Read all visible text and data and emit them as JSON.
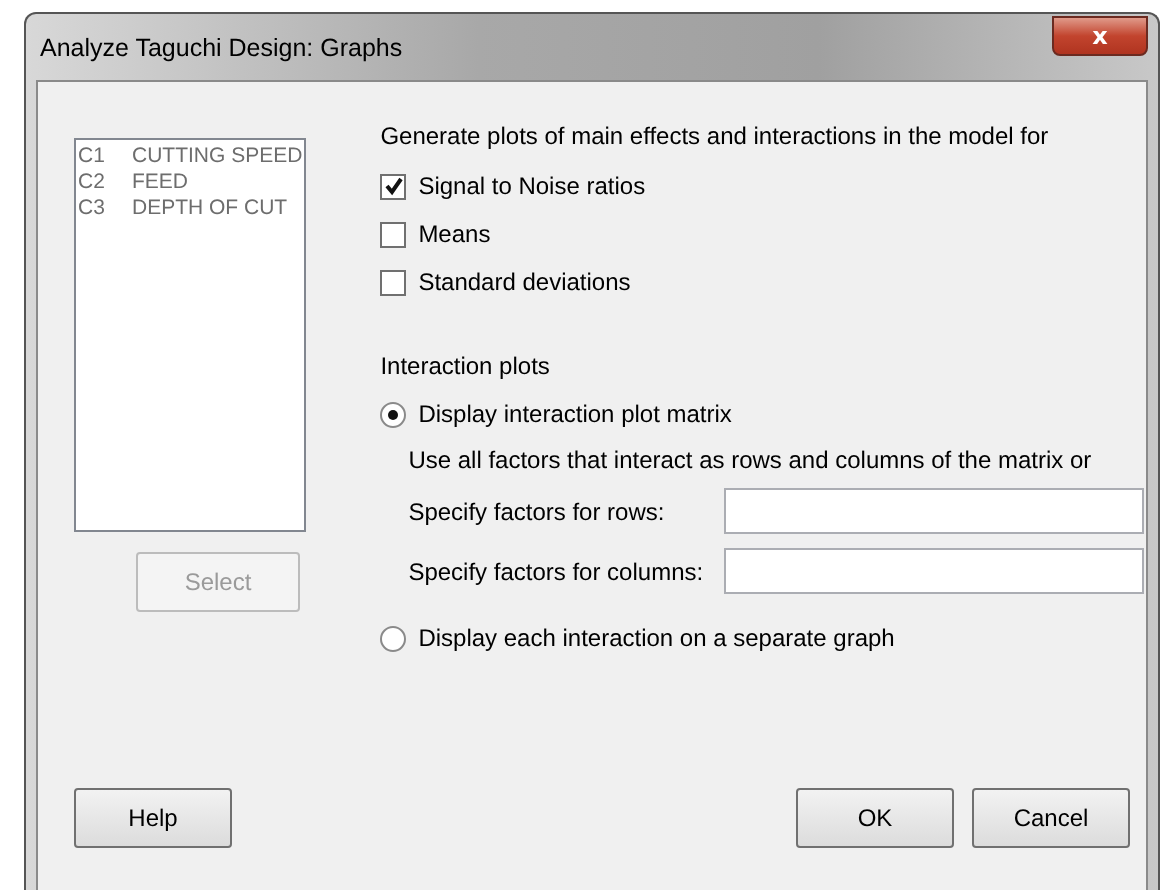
{
  "window": {
    "title": "Analyze Taguchi Design: Graphs",
    "close": "x"
  },
  "variables": [
    {
      "id": "C1",
      "name": "CUTTING SPEED"
    },
    {
      "id": "C2",
      "name": "FEED"
    },
    {
      "id": "C3",
      "name": "DEPTH OF CUT"
    }
  ],
  "select_button": {
    "label": "Select",
    "disabled": true
  },
  "plots_heading": "Generate plots of main effects and interactions in the model for",
  "plot_options": [
    {
      "label": "Signal to Noise ratios",
      "checked": true
    },
    {
      "label": "Means",
      "checked": false
    },
    {
      "label": "Standard deviations",
      "checked": false
    }
  ],
  "interaction_heading": "Interaction plots",
  "matrix_option": {
    "label": "Display interaction plot matrix",
    "selected": true
  },
  "matrix_note": "Use all factors that interact as rows and columns of the matrix or",
  "fields": [
    {
      "label": "Specify factors for rows:"
    },
    {
      "label": "Specify factors for columns:"
    }
  ],
  "separate_option": {
    "label": "Display each interaction on a separate graph",
    "selected": false
  },
  "buttons": {
    "help": "Help",
    "ok": "OK",
    "cancel": "Cancel"
  }
}
